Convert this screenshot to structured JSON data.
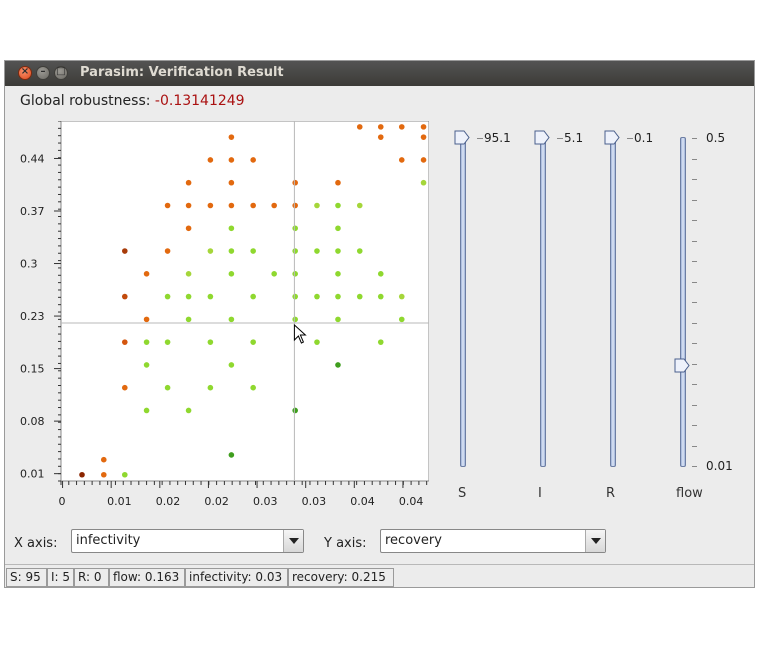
{
  "window": {
    "title": "Parasim: Verification Result",
    "controls": {
      "close": "×",
      "minimize": "–",
      "maximize": "□"
    }
  },
  "robustness": {
    "label": "Global robustness:",
    "value": "-0.13141249",
    "value_color": "#aa1111"
  },
  "chart_data": {
    "type": "scatter",
    "title": "",
    "xlabel": "infectivity",
    "ylabel": "recovery",
    "x_tick_labels": [
      "0",
      "0.01",
      "0.02",
      "0.02",
      "0.03",
      "0.03",
      "0.04",
      "0.04"
    ],
    "y_tick_labels": [
      "0.01",
      "0.08",
      "0.15",
      "0.23",
      "0.3",
      "0.37",
      "0.44"
    ],
    "xlim": [
      0.0,
      0.0473
    ],
    "ylim": [
      0.0,
      0.49
    ],
    "crosshair": {
      "x": 0.03,
      "y": 0.215
    },
    "grid": false,
    "color_scale": {
      "negative_dark": "#8b2500",
      "negative": "#e2690f",
      "near_zero": "#a5d63a",
      "positive": "#77e22b",
      "positive_dark": "#2e9e1f"
    },
    "points": [
      {
        "x": 0.0027,
        "y": 0.0085,
        "color": "#8b2500"
      },
      {
        "x": 0.0055,
        "y": 0.0085,
        "color": "#e2690f"
      },
      {
        "x": 0.0082,
        "y": 0.0085,
        "color": "#8fd82f"
      },
      {
        "x": 0.0055,
        "y": 0.029,
        "color": "#e2690f"
      },
      {
        "x": 0.0219,
        "y": 0.0355,
        "color": "#3f9e1e"
      },
      {
        "x": 0.011,
        "y": 0.096,
        "color": "#8fd82f"
      },
      {
        "x": 0.0164,
        "y": 0.096,
        "color": "#8fd82f"
      },
      {
        "x": 0.0301,
        "y": 0.096,
        "color": "#3f9e1e"
      },
      {
        "x": 0.0082,
        "y": 0.127,
        "color": "#e2690f"
      },
      {
        "x": 0.0137,
        "y": 0.127,
        "color": "#8fd82f"
      },
      {
        "x": 0.0192,
        "y": 0.127,
        "color": "#8fd82f"
      },
      {
        "x": 0.0247,
        "y": 0.127,
        "color": "#8fd82f"
      },
      {
        "x": 0.011,
        "y": 0.158,
        "color": "#8fd82f"
      },
      {
        "x": 0.0219,
        "y": 0.158,
        "color": "#8fd82f"
      },
      {
        "x": 0.0356,
        "y": 0.158,
        "color": "#3f9e1e"
      },
      {
        "x": 0.0082,
        "y": 0.189,
        "color": "#d4560e"
      },
      {
        "x": 0.011,
        "y": 0.189,
        "color": "#8fd82f"
      },
      {
        "x": 0.0137,
        "y": 0.189,
        "color": "#8fd82f"
      },
      {
        "x": 0.0192,
        "y": 0.189,
        "color": "#8fd82f"
      },
      {
        "x": 0.0247,
        "y": 0.189,
        "color": "#8fd82f"
      },
      {
        "x": 0.0329,
        "y": 0.189,
        "color": "#8fd82f"
      },
      {
        "x": 0.0411,
        "y": 0.189,
        "color": "#8fd82f"
      },
      {
        "x": 0.011,
        "y": 0.22,
        "color": "#e2690f"
      },
      {
        "x": 0.0164,
        "y": 0.22,
        "color": "#8fd82f"
      },
      {
        "x": 0.0219,
        "y": 0.22,
        "color": "#8fd82f"
      },
      {
        "x": 0.0301,
        "y": 0.22,
        "color": "#8fd82f"
      },
      {
        "x": 0.0356,
        "y": 0.22,
        "color": "#8fd82f"
      },
      {
        "x": 0.0438,
        "y": 0.22,
        "color": "#8fd82f"
      },
      {
        "x": 0.0082,
        "y": 0.251,
        "color": "#c24a0c"
      },
      {
        "x": 0.0137,
        "y": 0.251,
        "color": "#8fd82f"
      },
      {
        "x": 0.0164,
        "y": 0.251,
        "color": "#8fd82f"
      },
      {
        "x": 0.0192,
        "y": 0.251,
        "color": "#8fd82f"
      },
      {
        "x": 0.0247,
        "y": 0.251,
        "color": "#8fd82f"
      },
      {
        "x": 0.0301,
        "y": 0.251,
        "color": "#8fd82f"
      },
      {
        "x": 0.0329,
        "y": 0.251,
        "color": "#8fd82f"
      },
      {
        "x": 0.0356,
        "y": 0.251,
        "color": "#8fd82f"
      },
      {
        "x": 0.0384,
        "y": 0.251,
        "color": "#8fd82f"
      },
      {
        "x": 0.0411,
        "y": 0.251,
        "color": "#8fd82f"
      },
      {
        "x": 0.0438,
        "y": 0.251,
        "color": "#a5d63a"
      },
      {
        "x": 0.011,
        "y": 0.282,
        "color": "#e2690f"
      },
      {
        "x": 0.0164,
        "y": 0.282,
        "color": "#a5d63a"
      },
      {
        "x": 0.0219,
        "y": 0.282,
        "color": "#8fd82f"
      },
      {
        "x": 0.0274,
        "y": 0.282,
        "color": "#8fd82f"
      },
      {
        "x": 0.0301,
        "y": 0.282,
        "color": "#8fd82f"
      },
      {
        "x": 0.0356,
        "y": 0.282,
        "color": "#8fd82f"
      },
      {
        "x": 0.0411,
        "y": 0.282,
        "color": "#8fd82f"
      },
      {
        "x": 0.0082,
        "y": 0.313,
        "color": "#a83c0a"
      },
      {
        "x": 0.0137,
        "y": 0.313,
        "color": "#e2690f"
      },
      {
        "x": 0.0192,
        "y": 0.313,
        "color": "#a5d63a"
      },
      {
        "x": 0.0219,
        "y": 0.313,
        "color": "#8fd82f"
      },
      {
        "x": 0.0247,
        "y": 0.313,
        "color": "#8fd82f"
      },
      {
        "x": 0.0301,
        "y": 0.313,
        "color": "#8fd82f"
      },
      {
        "x": 0.0329,
        "y": 0.313,
        "color": "#8fd82f"
      },
      {
        "x": 0.0356,
        "y": 0.313,
        "color": "#8fd82f"
      },
      {
        "x": 0.0384,
        "y": 0.313,
        "color": "#8fd82f"
      },
      {
        "x": 0.0164,
        "y": 0.344,
        "color": "#e2690f"
      },
      {
        "x": 0.0219,
        "y": 0.344,
        "color": "#8fd82f"
      },
      {
        "x": 0.0301,
        "y": 0.344,
        "color": "#8fd82f"
      },
      {
        "x": 0.0356,
        "y": 0.344,
        "color": "#8fd82f"
      },
      {
        "x": 0.0137,
        "y": 0.375,
        "color": "#e2690f"
      },
      {
        "x": 0.0164,
        "y": 0.375,
        "color": "#e2690f"
      },
      {
        "x": 0.0192,
        "y": 0.375,
        "color": "#e2690f"
      },
      {
        "x": 0.0219,
        "y": 0.375,
        "color": "#e2690f"
      },
      {
        "x": 0.0247,
        "y": 0.375,
        "color": "#e2690f"
      },
      {
        "x": 0.0274,
        "y": 0.375,
        "color": "#e2690f"
      },
      {
        "x": 0.0301,
        "y": 0.375,
        "color": "#e2690f"
      },
      {
        "x": 0.0329,
        "y": 0.375,
        "color": "#a5d63a"
      },
      {
        "x": 0.0356,
        "y": 0.375,
        "color": "#8fd82f"
      },
      {
        "x": 0.0384,
        "y": 0.375,
        "color": "#a5d63a"
      },
      {
        "x": 0.0164,
        "y": 0.406,
        "color": "#e2690f"
      },
      {
        "x": 0.0219,
        "y": 0.406,
        "color": "#e2690f"
      },
      {
        "x": 0.0301,
        "y": 0.406,
        "color": "#e2690f"
      },
      {
        "x": 0.0356,
        "y": 0.406,
        "color": "#e2690f"
      },
      {
        "x": 0.0192,
        "y": 0.437,
        "color": "#e2690f"
      },
      {
        "x": 0.0219,
        "y": 0.437,
        "color": "#e2690f"
      },
      {
        "x": 0.0247,
        "y": 0.437,
        "color": "#e2690f"
      },
      {
        "x": 0.0219,
        "y": 0.468,
        "color": "#e2690f"
      },
      {
        "x": 0.0384,
        "y": 0.482,
        "color": "#e2690f"
      },
      {
        "x": 0.0411,
        "y": 0.482,
        "color": "#e2690f"
      },
      {
        "x": 0.0438,
        "y": 0.482,
        "color": "#e2690f"
      },
      {
        "x": 0.0466,
        "y": 0.482,
        "color": "#e2690f"
      },
      {
        "x": 0.0411,
        "y": 0.468,
        "color": "#e2690f"
      },
      {
        "x": 0.0466,
        "y": 0.468,
        "color": "#e2690f"
      },
      {
        "x": 0.0438,
        "y": 0.437,
        "color": "#e2690f"
      },
      {
        "x": 0.0466,
        "y": 0.437,
        "color": "#e2690f"
      },
      {
        "x": 0.0466,
        "y": 0.406,
        "color": "#a5d63a"
      }
    ]
  },
  "sliders": [
    {
      "name": "S",
      "high_label": "95.1",
      "thumb_fraction": 1.0
    },
    {
      "name": "I",
      "high_label": "5.1",
      "thumb_fraction": 1.0
    },
    {
      "name": "R",
      "high_label": "0.1",
      "thumb_fraction": 1.0
    },
    {
      "name": "flow",
      "high_label": "0.5",
      "low_label": "0.01",
      "thumb_fraction": 0.31
    }
  ],
  "axes_controls": {
    "x_label": "X axis:",
    "x_value": "infectivity",
    "y_label": "Y axis:",
    "y_value": "recovery"
  },
  "status": {
    "s": "S: 95",
    "i": "I: 5",
    "r": "R: 0",
    "flow": "flow: 0.163",
    "infectivity": "infectivity: 0.03",
    "recovery": "recovery: 0.215"
  }
}
